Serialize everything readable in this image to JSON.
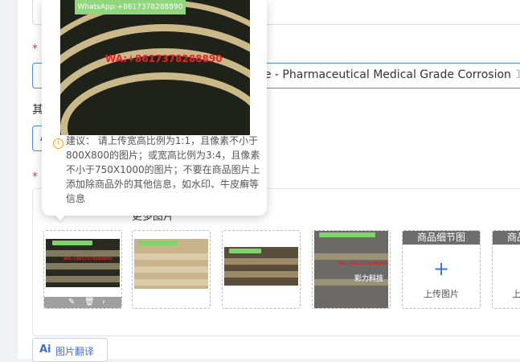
{
  "colors": {
    "required": "#e4393c",
    "accent": "#3f6fd8",
    "focus_border": "#4a90e2"
  },
  "form": {
    "required_mark": "*",
    "title_value": "ose - Pharmaceutical Medical Grade Corrosion",
    "title_count": "1",
    "other_label_fragment": "其",
    "ai_logo": "Ai",
    "more_images_label": "更多图片"
  },
  "popover": {
    "watermark_top": "WhatsApp:+8617378288890",
    "watermark_red": "WA:+8617378288890",
    "tip_icon": "info-icon",
    "tip_text": "建议： 请上传宽高比例为1:1，且像素不小于800X800的图片；或宽高比例为3:4，且像素不小于750X1000的图片；不要在商品图片上添加除商品外的其他信息，如水印、牛皮癣等信息"
  },
  "thumbnails": {
    "edit_icon": "pencil-icon",
    "delete_icon": "trash-icon",
    "next_icon": "chevron-right-icon",
    "watermark": "WA:+8617378288890",
    "thumb4_sign": "彩力科技",
    "detail_header": "商品细节图",
    "detail_header_2": "商品",
    "plus": "+",
    "upload_label": "上传图片",
    "upload_label_2": "上"
  },
  "translate": {
    "logo": "Ai",
    "label": "图片翻译"
  }
}
